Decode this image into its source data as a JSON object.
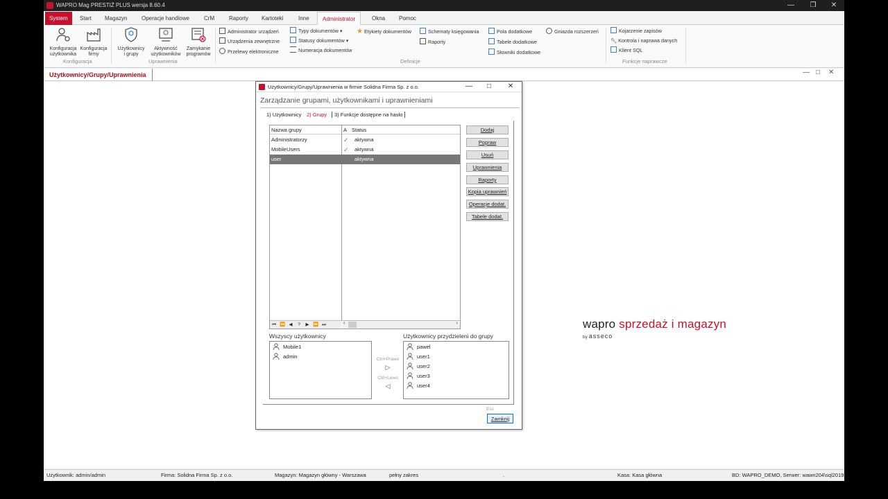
{
  "app": {
    "title": "WAPRO Mag PRESTIŻ PLUS  wersja 8.60.4",
    "window_controls": {
      "minimize": "—",
      "restore": "❐",
      "close": "✕"
    }
  },
  "menu": {
    "items": [
      "System",
      "Start",
      "Magazyn",
      "Operacje handlowe",
      "CrM",
      "Raporty",
      "Kartoteki",
      "Inne",
      "Administrator",
      "Okna",
      "Pomoc"
    ],
    "active": "Administrator"
  },
  "ribbon": {
    "konfiguracja": {
      "group": "Konfiguracja",
      "btn1": [
        "Konfiguracja",
        "użytkownika"
      ],
      "btn2": [
        "Konfiguracja",
        "firmy"
      ]
    },
    "uprawnienia": {
      "group": "Uprawnienia",
      "btn1": [
        "Użytkownicy",
        "i grupy"
      ],
      "btn2": [
        "Aktywność",
        "użytkowników"
      ],
      "btn3": [
        "Zamykanie",
        "programów"
      ]
    },
    "definicje": {
      "group": "Definicje",
      "col1": [
        "Administrator urządzeń",
        "Urządzenia zewnętrzne",
        "Przelewy elektroniczne"
      ],
      "col2": [
        "Typy dokumentów",
        "Statusy dokumentów",
        "Numeracja dokumentów"
      ],
      "col3": [
        "Etykiety dokumentów"
      ],
      "col4": [
        "Schematy księgowania",
        "Raporty"
      ],
      "col5": [
        "Pola dodatkowe",
        "Tabele dodatkowe",
        "Słowniki dodatkowe"
      ],
      "col6": [
        "Gniazda rozszerzeń"
      ]
    },
    "naprawcze": {
      "group": "Funkcje naprawcze",
      "items": [
        "Kojarzenie zapisów",
        "Kontrola i naprawa danych",
        "Klient SQL"
      ]
    }
  },
  "doc_tab": {
    "label": "Użytkownicy/Grupy/Uprawnienia"
  },
  "dialog": {
    "title": "Użytkownicy/Grupy/Uprawnienia w firmie Solidna Firma Sp. z o.o.",
    "heading": "Zarządzanie grupami, użytkownikami i uprawnieniami",
    "tabs": [
      "1) Użytkownicy",
      "2) Grupy",
      "3) Funkcje dostępne na hasło"
    ],
    "active_tab": "2) Grupy",
    "grid": {
      "col_name": "Nazwa grupy",
      "col_a": "A",
      "col_status": "Status",
      "rows": [
        {
          "name": "Administratorzy",
          "status": "aktywna",
          "checked": true,
          "selected": false
        },
        {
          "name": "MobileUsers",
          "status": "aktywna",
          "checked": true,
          "selected": false
        },
        {
          "name": "user",
          "status": "aktywna",
          "checked": false,
          "selected": true
        }
      ]
    },
    "buttons": [
      "Dodaj",
      "Popraw",
      "Usuń",
      "Uprawnienia",
      "Raporty",
      "Kopia uprawnień",
      "Operacje dodat.",
      "Tabele dodat."
    ],
    "all_users_label": "Wszyscy użytkownicy",
    "all_users": [
      "Mobile1",
      "admin"
    ],
    "assigned_label": "Użytkownicy przydzieleni do grupy",
    "assigned_users": [
      "pawel",
      "user1",
      "user2",
      "user3",
      "user4"
    ],
    "move_right": "Ctrl+Prawo",
    "move_left": "Ctrl+Lewo",
    "esc_hint": "Esc",
    "close_button": "Zamknij"
  },
  "statusbar": {
    "user": "Użytkownik: admin/admin",
    "company": "Firma: Solidna Firma Sp. z o.o.",
    "warehouse": "Magazyn: Magazyn główny - Warszawa",
    "scope": "pełny zakres",
    "dot": ".",
    "cash": "Kasa: Kasa główna",
    "db": "BD: WAPRO_DEMO, Serwer: wawn204\\sql2019"
  },
  "logo": {
    "brand": "wapro",
    "product": "sprzedaż i magazyn",
    "by": "by",
    "company": "asseco"
  },
  "colors": {
    "accent": "#c8102e",
    "selection": "#777777",
    "check": "#3a9a3a"
  }
}
